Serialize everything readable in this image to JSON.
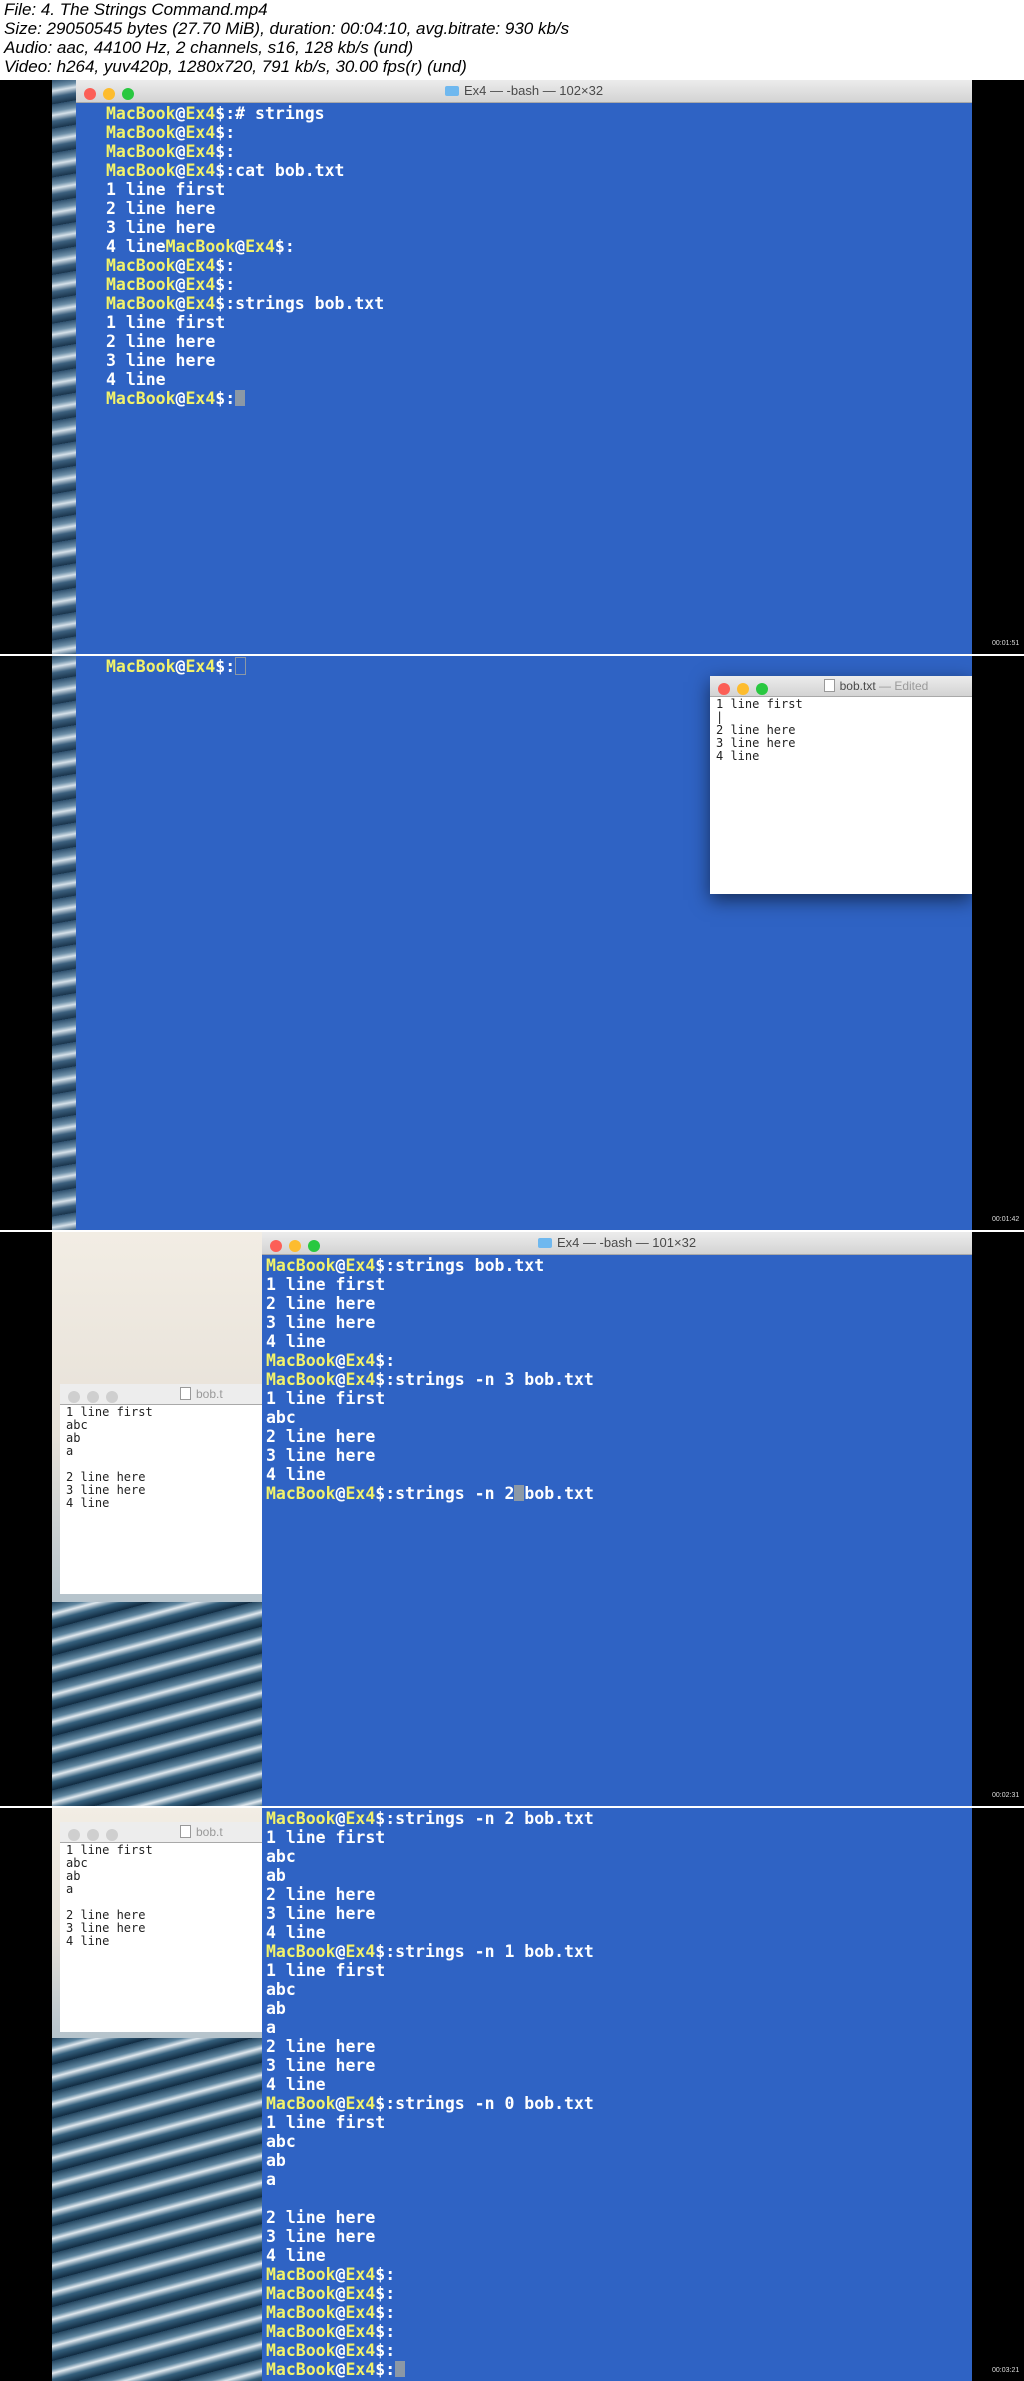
{
  "header": {
    "lines": [
      "File: 4. The Strings Command.mp4",
      "Size: 29050545 bytes (27.70 MiB), duration: 00:04:10, avg.bitrate: 930 kb/s",
      "Audio: aac, 44100 Hz, 2 channels, s16, 128 kb/s (und)",
      "Video: h264, yuv420p, 1280x720, 791 kb/s, 30.00 fps(r) (und)"
    ]
  },
  "prompt": {
    "host": "MacBook",
    "at": "@",
    "dir": "Ex4",
    "suffix": "$:"
  },
  "frames": [
    {
      "terminal_title": "Ex4 — -bash — 102×32",
      "timestamp": "00:01:51",
      "lines": [
        {
          "p": true,
          "t": "# strings"
        },
        {
          "p": true,
          "t": ""
        },
        {
          "p": true,
          "t": ""
        },
        {
          "p": true,
          "t": "cat bob.txt"
        },
        {
          "p": false,
          "t": "1 line first"
        },
        {
          "p": false,
          "t": "2 line here"
        },
        {
          "p": false,
          "t": "3 line here"
        },
        {
          "p": false,
          "t": "4 line",
          "tail_prompt": true
        },
        {
          "p": true,
          "t": ""
        },
        {
          "p": true,
          "t": ""
        },
        {
          "p": true,
          "t": "strings bob.txt"
        },
        {
          "p": false,
          "t": "1 line first"
        },
        {
          "p": false,
          "t": "2 line here"
        },
        {
          "p": false,
          "t": "3 line here"
        },
        {
          "p": false,
          "t": "4 line"
        },
        {
          "p": true,
          "t": "",
          "cursor": "solid"
        }
      ]
    },
    {
      "timestamp": "00:01:42",
      "lines": [
        {
          "p": true,
          "t": "",
          "cursor": "outline"
        }
      ],
      "editor": {
        "title": "bob.txt",
        "status": "— Edited",
        "lines": [
          "1 line first",
          "|",
          "2 line here",
          "3 line here",
          "4 line"
        ]
      }
    },
    {
      "terminal_title": "Ex4 — -bash — 101×32",
      "timestamp": "00:02:31",
      "lines": [
        {
          "p": true,
          "t": "strings bob.txt"
        },
        {
          "p": false,
          "t": "1 line first"
        },
        {
          "p": false,
          "t": "2 line here"
        },
        {
          "p": false,
          "t": "3 line here"
        },
        {
          "p": false,
          "t": "4 line"
        },
        {
          "p": true,
          "t": ""
        },
        {
          "p": true,
          "t": "strings -n 3 bob.txt"
        },
        {
          "p": false,
          "t": "1 line first"
        },
        {
          "p": false,
          "t": "abc"
        },
        {
          "p": false,
          "t": "2 line here"
        },
        {
          "p": false,
          "t": "3 line here"
        },
        {
          "p": false,
          "t": "4 line"
        },
        {
          "p": true,
          "t": "strings -n 2",
          "cursor_mid": true,
          "t2": "bob.txt"
        }
      ],
      "editor": {
        "title": "bob.t",
        "lines": [
          "1 line first",
          "abc",
          "ab",
          "a",
          "",
          "2 line here",
          "3 line here",
          "4 line"
        ]
      }
    },
    {
      "timestamp": "00:03:21",
      "lines": [
        {
          "p": true,
          "t": "strings -n 2 bob.txt"
        },
        {
          "p": false,
          "t": "1 line first"
        },
        {
          "p": false,
          "t": "abc"
        },
        {
          "p": false,
          "t": "ab"
        },
        {
          "p": false,
          "t": "2 line here"
        },
        {
          "p": false,
          "t": "3 line here"
        },
        {
          "p": false,
          "t": "4 line"
        },
        {
          "p": true,
          "t": "strings -n 1 bob.txt"
        },
        {
          "p": false,
          "t": "1 line first"
        },
        {
          "p": false,
          "t": "abc"
        },
        {
          "p": false,
          "t": "ab"
        },
        {
          "p": false,
          "t": "a"
        },
        {
          "p": false,
          "t": "2 line here"
        },
        {
          "p": false,
          "t": "3 line here"
        },
        {
          "p": false,
          "t": "4 line"
        },
        {
          "p": true,
          "t": "strings -n 0 bob.txt"
        },
        {
          "p": false,
          "t": "1 line first"
        },
        {
          "p": false,
          "t": "abc"
        },
        {
          "p": false,
          "t": "ab"
        },
        {
          "p": false,
          "t": "a"
        },
        {
          "p": false,
          "t": ""
        },
        {
          "p": false,
          "t": "2 line here"
        },
        {
          "p": false,
          "t": "3 line here"
        },
        {
          "p": false,
          "t": "4 line"
        },
        {
          "p": true,
          "t": ""
        },
        {
          "p": true,
          "t": ""
        },
        {
          "p": true,
          "t": ""
        },
        {
          "p": true,
          "t": ""
        },
        {
          "p": true,
          "t": ""
        },
        {
          "p": true,
          "t": "",
          "cursor": "solid"
        }
      ],
      "editor": {
        "title": "bob.t",
        "lines": [
          "1 line first",
          "abc",
          "ab",
          "a",
          "",
          "2 line here",
          "3 line here",
          "4 line"
        ]
      }
    }
  ]
}
